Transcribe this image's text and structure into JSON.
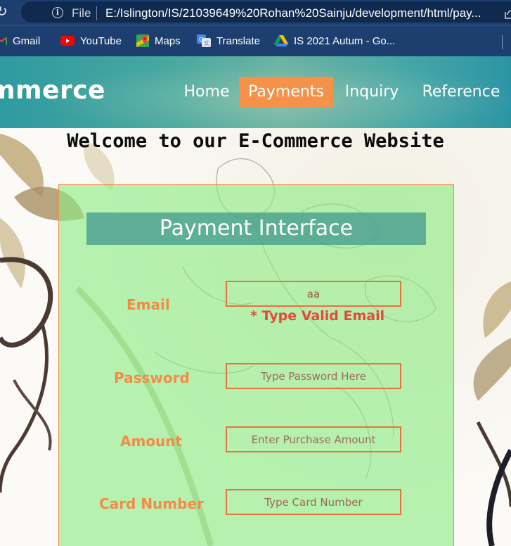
{
  "browser": {
    "protocol_label": "File",
    "url": "E:/Islington/IS/21039649%20Rohan%20Sainju/development/html/pay...",
    "bookmarks": [
      {
        "label": "Gmail",
        "icon": "gmail-icon"
      },
      {
        "label": "YouTube",
        "icon": "youtube-icon"
      },
      {
        "label": "Maps",
        "icon": "maps-icon"
      },
      {
        "label": "Translate",
        "icon": "translate-icon"
      },
      {
        "label": "IS 2021 Autum - Go...",
        "icon": "drive-icon"
      }
    ]
  },
  "header": {
    "brand": "mmerce",
    "nav": [
      {
        "label": "Home",
        "active": false
      },
      {
        "label": "Payments",
        "active": true
      },
      {
        "label": "Inquiry",
        "active": false
      },
      {
        "label": "Reference",
        "active": false
      }
    ]
  },
  "welcome": "Welcome to our E-Commerce Website",
  "form": {
    "title": "Payment Interface",
    "email": {
      "label": "Email",
      "value": "aa",
      "error": "* Type Valid Email"
    },
    "password": {
      "label": "Password",
      "placeholder": "Type Password Here"
    },
    "amount": {
      "label": "Amount",
      "placeholder": "Enter Purchase Amount"
    },
    "card": {
      "label": "Card Number",
      "placeholder": "Type Card Number"
    }
  },
  "colors": {
    "accent": "#f39248",
    "header_teal": "#3aa3a3",
    "panel_green": "#8ceb82",
    "label_orange": "#f48a4a",
    "error_red": "#e8483a"
  }
}
